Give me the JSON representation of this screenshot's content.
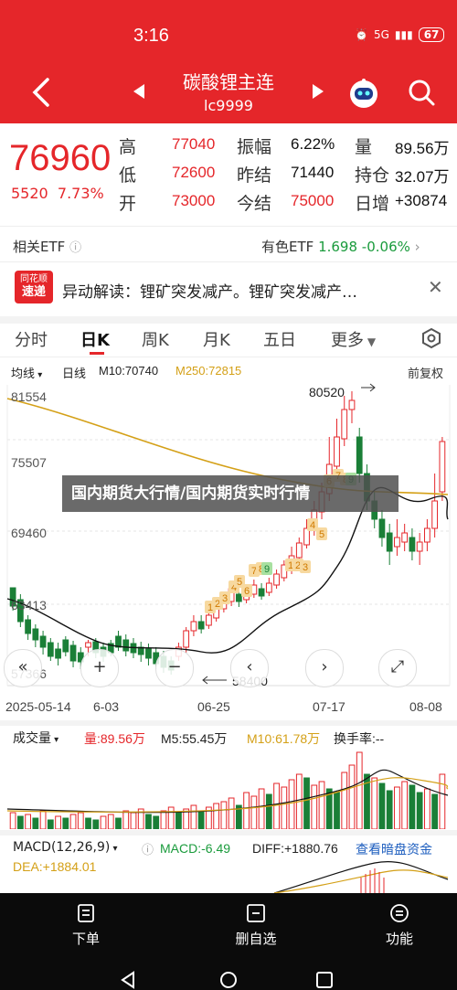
{
  "status": {
    "time": "3:16",
    "network": "5G",
    "battery": "67"
  },
  "header": {
    "title": "碳酸锂主连",
    "code": "lc9999"
  },
  "icons": {
    "back": "back-arrow-icon",
    "prev": "prev-triangle-icon",
    "next": "next-triangle-icon",
    "robot": "robot-assistant-icon",
    "search": "search-icon"
  },
  "quote": {
    "price": "76960",
    "change": "5520",
    "change_pct": "7.73%",
    "rows": [
      {
        "l1": "高",
        "v1": "77040",
        "l2": "振幅",
        "v2": "6.22%",
        "l3": "量",
        "v3": "89.56万"
      },
      {
        "l1": "低",
        "v1": "72600",
        "l2": "昨结",
        "v2": "71440",
        "l3": "持仓",
        "v3": "32.07万"
      },
      {
        "l1": "开",
        "v1": "73000",
        "l2": "今结",
        "v2": "75000",
        "l3": "日增",
        "v3": "+30874"
      }
    ]
  },
  "etf": {
    "left_label": "相关ETF",
    "right_label": "有色ETF",
    "right_price": "1.698",
    "right_change": "-0.06%"
  },
  "news": {
    "badge_top": "同花顺",
    "badge_bottom": "速递",
    "text": "异动解读：锂矿突发减产。锂矿突发减产…"
  },
  "tabs": [
    "分时",
    "日K",
    "周K",
    "月K",
    "五日",
    "更多"
  ],
  "kline": {
    "ma_select": "均线",
    "period": "日线",
    "m10": "M10:70740",
    "m250": "M250:72815",
    "adjust": "前复权",
    "axis": [
      "81554",
      "75507",
      "69460",
      "63413",
      "57366"
    ],
    "high_mark": "80520",
    "low_mark": "58400",
    "dates": [
      "2025-05-14",
      "6-03",
      "06-25",
      "07-17",
      "08-08"
    ],
    "overlay_text": "国内期货大行情/国内期货实时行情",
    "signals": [
      "1",
      "2",
      "3",
      "4",
      "5",
      "6",
      "7",
      "8",
      "9",
      "1",
      "2",
      "3",
      "4",
      "5",
      "6",
      "7",
      "8",
      "9"
    ]
  },
  "volume": {
    "title": "成交量",
    "vol": "量:89.56万",
    "m5": "M5:55.45万",
    "m10": "M10:61.78万",
    "turnover": "换手率:--"
  },
  "macd": {
    "title": "MACD(12,26,9)",
    "macd": "MACD:-6.49",
    "diff": "DIFF:+1880.76",
    "link": "查看暗盘资金",
    "dea": "DEA:+1884.01"
  },
  "bottom_nav": [
    {
      "label": "下单",
      "icon": "order-icon"
    },
    {
      "label": "删自选",
      "icon": "remove-watchlist-icon"
    },
    {
      "label": "功能",
      "icon": "menu-icon"
    }
  ],
  "colors": {
    "brand_red": "#e5262a",
    "up_red": "#e5262a",
    "down_green": "#1a7f37",
    "ma_yellow": "#d4a017"
  }
}
